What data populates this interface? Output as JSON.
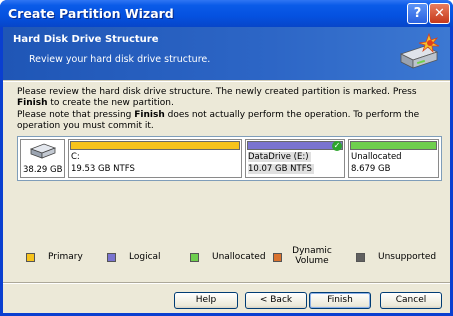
{
  "window": {
    "title": "Create Partition Wizard",
    "help_glyph": "?",
    "close_glyph": "✕"
  },
  "header": {
    "title": "Hard Disk Drive Structure",
    "subtitle": "Review your hard disk drive structure."
  },
  "instructions": {
    "line1_pre": "Please review the hard disk drive structure. The newly created partition is marked. Press ",
    "line1_bold": "Finish",
    "line1_post": " to create the new partition.",
    "line2_pre": "Please note that pressing ",
    "line2_bold": "Finish",
    "line2_post": " does not actually perform the operation. To perform the operation you must commit it."
  },
  "disk": {
    "size": "38.29 GB",
    "partitions": [
      {
        "name": "C:",
        "size": "19.53 GB",
        "fs": "NTFS",
        "type": "Primary",
        "color": "#f7c31c",
        "selected": false
      },
      {
        "name": "DataDrive (E:)",
        "size": "10.07 GB",
        "fs": "NTFS",
        "type": "Logical",
        "color": "#7a74d0",
        "selected": true
      },
      {
        "name": "Unallocated",
        "size": "8.679 GB",
        "fs": "",
        "type": "Unallocated",
        "color": "#6ecf4e",
        "selected": false
      }
    ]
  },
  "legend": [
    {
      "label": "Primary",
      "color": "#f7c31c"
    },
    {
      "label": "Logical",
      "color": "#7a74d0"
    },
    {
      "label": "Unallocated",
      "color": "#6ecf4e"
    },
    {
      "label": "Dynamic Volume",
      "color": "#d9722e"
    },
    {
      "label": "Unsupported",
      "color": "#606060"
    }
  ],
  "buttons": {
    "help": "Help",
    "back": "< Back",
    "finish": "Finish",
    "cancel": "Cancel"
  }
}
